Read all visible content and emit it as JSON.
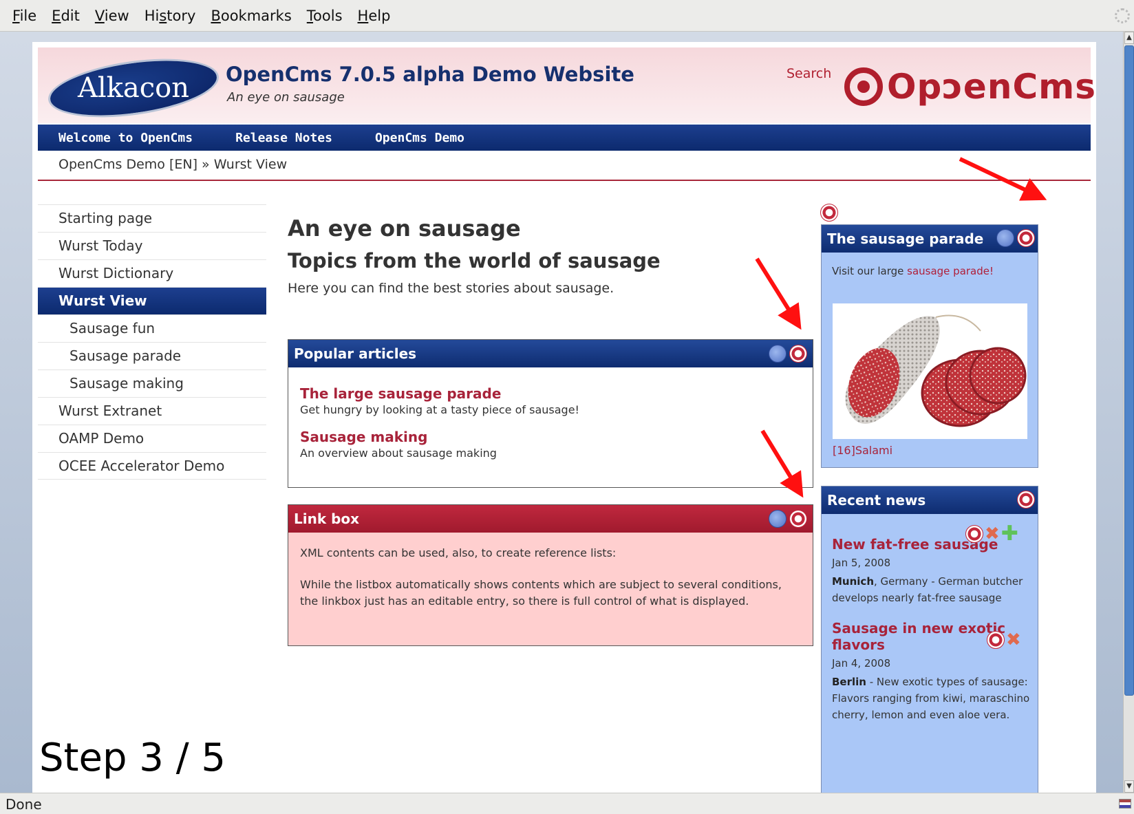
{
  "browser": {
    "menu": [
      {
        "pre": "",
        "u": "F",
        "post": "ile"
      },
      {
        "pre": "",
        "u": "E",
        "post": "dit"
      },
      {
        "pre": "",
        "u": "V",
        "post": "iew"
      },
      {
        "pre": "Hi",
        "u": "s",
        "post": "tory"
      },
      {
        "pre": "",
        "u": "B",
        "post": "ookmarks"
      },
      {
        "pre": "",
        "u": "T",
        "post": "ools"
      },
      {
        "pre": "",
        "u": "H",
        "post": "elp"
      }
    ],
    "status": "Done"
  },
  "header": {
    "alkacon_logo": "Alkacon",
    "title": "OpenCms 7.0.5 alpha Demo Website",
    "subtitle": "An eye on sausage",
    "search": "Search",
    "opencms_logo": "OpenCms"
  },
  "nav": [
    "Welcome to OpenCms",
    "Release Notes",
    "OpenCms Demo"
  ],
  "breadcrumb": "OpenCms Demo [EN]  »  Wurst View",
  "sidebar": {
    "items": [
      {
        "label": "Starting page",
        "level": 0,
        "active": false
      },
      {
        "label": "Wurst Today",
        "level": 0,
        "active": false
      },
      {
        "label": "Wurst Dictionary",
        "level": 0,
        "active": false
      },
      {
        "label": "Wurst View",
        "level": 0,
        "active": true
      },
      {
        "label": "Sausage fun",
        "level": 1,
        "active": false
      },
      {
        "label": "Sausage parade",
        "level": 1,
        "active": false
      },
      {
        "label": "Sausage making",
        "level": 1,
        "active": false
      },
      {
        "label": "Wurst Extranet",
        "level": 0,
        "active": false
      },
      {
        "label": "OAMP Demo",
        "level": 0,
        "active": false
      },
      {
        "label": "OCEE Accelerator Demo",
        "level": 0,
        "active": false
      }
    ]
  },
  "main": {
    "heading": "An eye on sausage",
    "subheading": "Topics from the world of sausage",
    "intro": "Here you can find the best stories about sausage.",
    "popular": {
      "title": "Popular articles",
      "articles": [
        {
          "title": "The large sausage parade",
          "desc": "Get hungry by looking at a tasty piece of sausage!"
        },
        {
          "title": "Sausage making",
          "desc": "An overview about sausage making"
        }
      ]
    },
    "linkbox": {
      "title": "Link box",
      "p1": "XML contents can be used, also, to create reference lists:",
      "p2": "While the listbox automatically shows contents which are subject to several conditions, the linkbox just has an editable entry, so there is full control of what is displayed."
    }
  },
  "right": {
    "parade": {
      "title": "The sausage parade",
      "visit_pre": "Visit our large ",
      "visit_link": "sausage parade!",
      "caption": "[16]Salami"
    },
    "news": {
      "title": "Recent news",
      "items": [
        {
          "title": "New fat-free sausage",
          "date": "Jan 5, 2008",
          "place": "Munich",
          "body": ", Germany - German butcher develops nearly fat-free sausage"
        },
        {
          "title": "Sausage in new exotic flavors",
          "date": "Jan 4, 2008",
          "place": "Berlin",
          "body": " - New exotic types of sausage: Flavors ranging from kiwi, maraschino cherry, lemon and even aloe vera."
        }
      ]
    }
  },
  "overlay": {
    "step": "Step 3 / 5"
  },
  "colors": {
    "nav_blue": "#0c2a6e",
    "accent_red": "#b01e2c",
    "link_red": "#a8233a",
    "arrow": "#ff1010"
  }
}
